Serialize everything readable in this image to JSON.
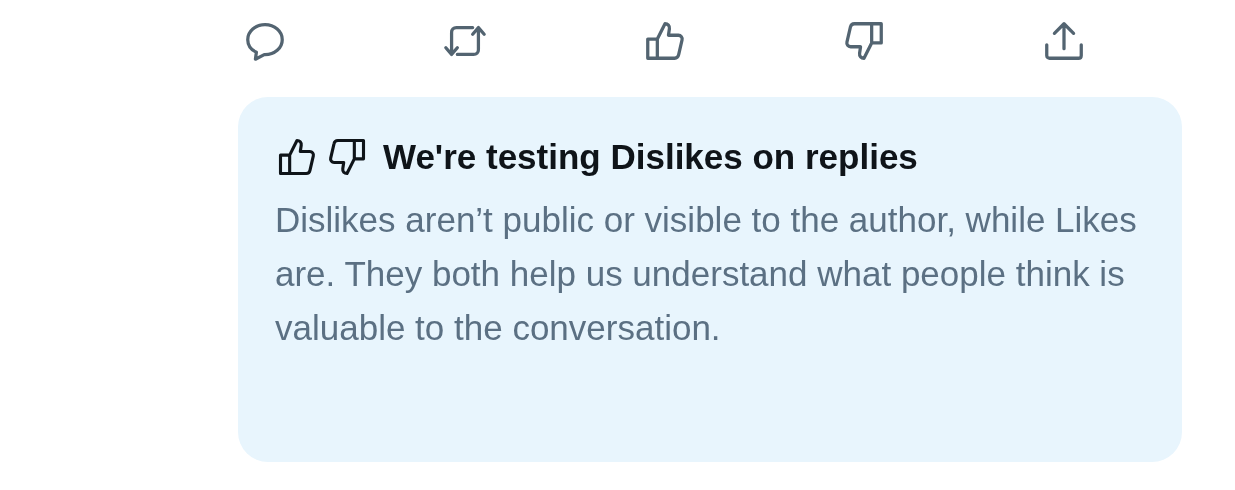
{
  "notice": {
    "title": "We're testing Dislikes on replies",
    "body": "Dislikes aren’t public or visible to the author, while Likes are. They both help us understand what people think is valuable to the conversation."
  }
}
